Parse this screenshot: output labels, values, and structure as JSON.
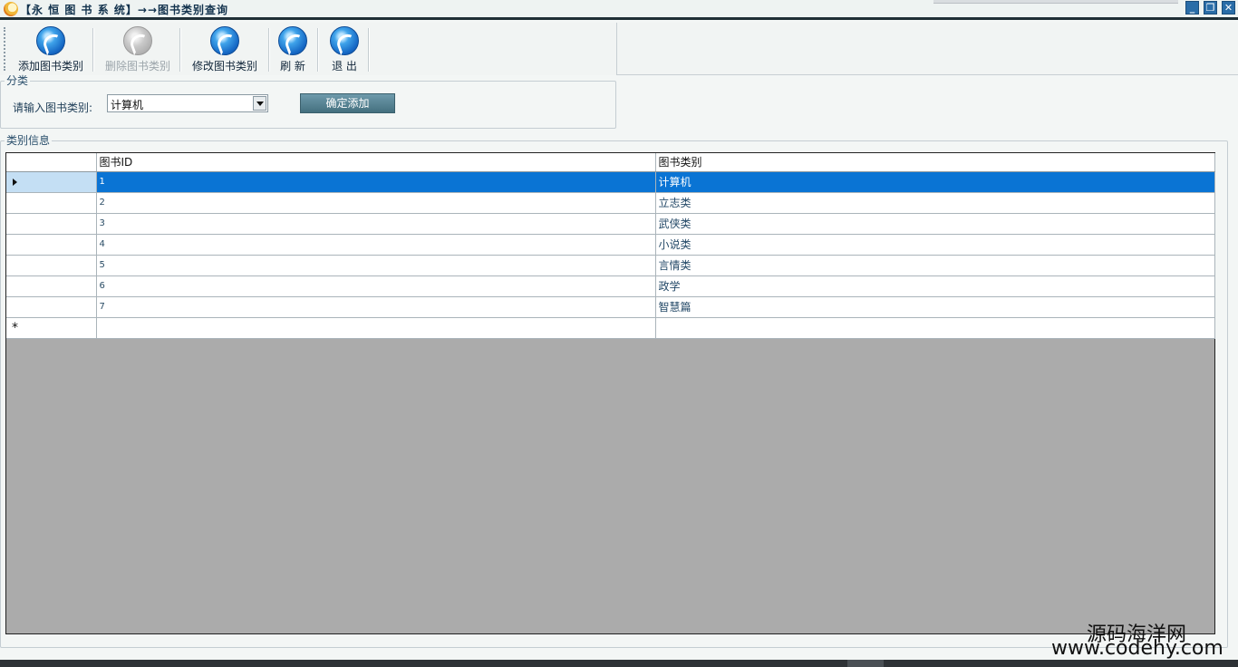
{
  "window": {
    "title": "【永 恒 图 书 系 统】→→图书类别查询",
    "min_label": "_",
    "max_label": "❐",
    "close_label": "✕"
  },
  "toolbar": {
    "buttons": [
      {
        "label": "添加图书类别",
        "icon": "add-globe-icon",
        "enabled": true
      },
      {
        "label": "删除图书类别",
        "icon": "delete-globe-icon",
        "enabled": false
      },
      {
        "label": "修改图书类别",
        "icon": "edit-globe-icon",
        "enabled": true
      },
      {
        "label": "刷 新",
        "icon": "refresh-icon",
        "enabled": true
      },
      {
        "label": "退 出",
        "icon": "exit-icon",
        "enabled": true
      }
    ]
  },
  "category_group": {
    "legend": "分类",
    "input_label": "请输入图书类别:",
    "combo_value": "计算机",
    "confirm_label": "确定添加"
  },
  "info_group": {
    "legend": "类别信息",
    "columns": [
      "图书ID",
      "图书类别"
    ],
    "rows": [
      {
        "id": "1",
        "category": "计算机"
      },
      {
        "id": "2",
        "category": "立志类"
      },
      {
        "id": "3",
        "category": "武侠类"
      },
      {
        "id": "4",
        "category": "小说类"
      },
      {
        "id": "5",
        "category": "言情类"
      },
      {
        "id": "6",
        "category": "政学"
      },
      {
        "id": "7",
        "category": "智慧篇"
      }
    ],
    "selected_row": 0,
    "new_row_marker": "*"
  },
  "watermark": {
    "line1": "源码海洋网",
    "line2": "www.codehy.com"
  }
}
